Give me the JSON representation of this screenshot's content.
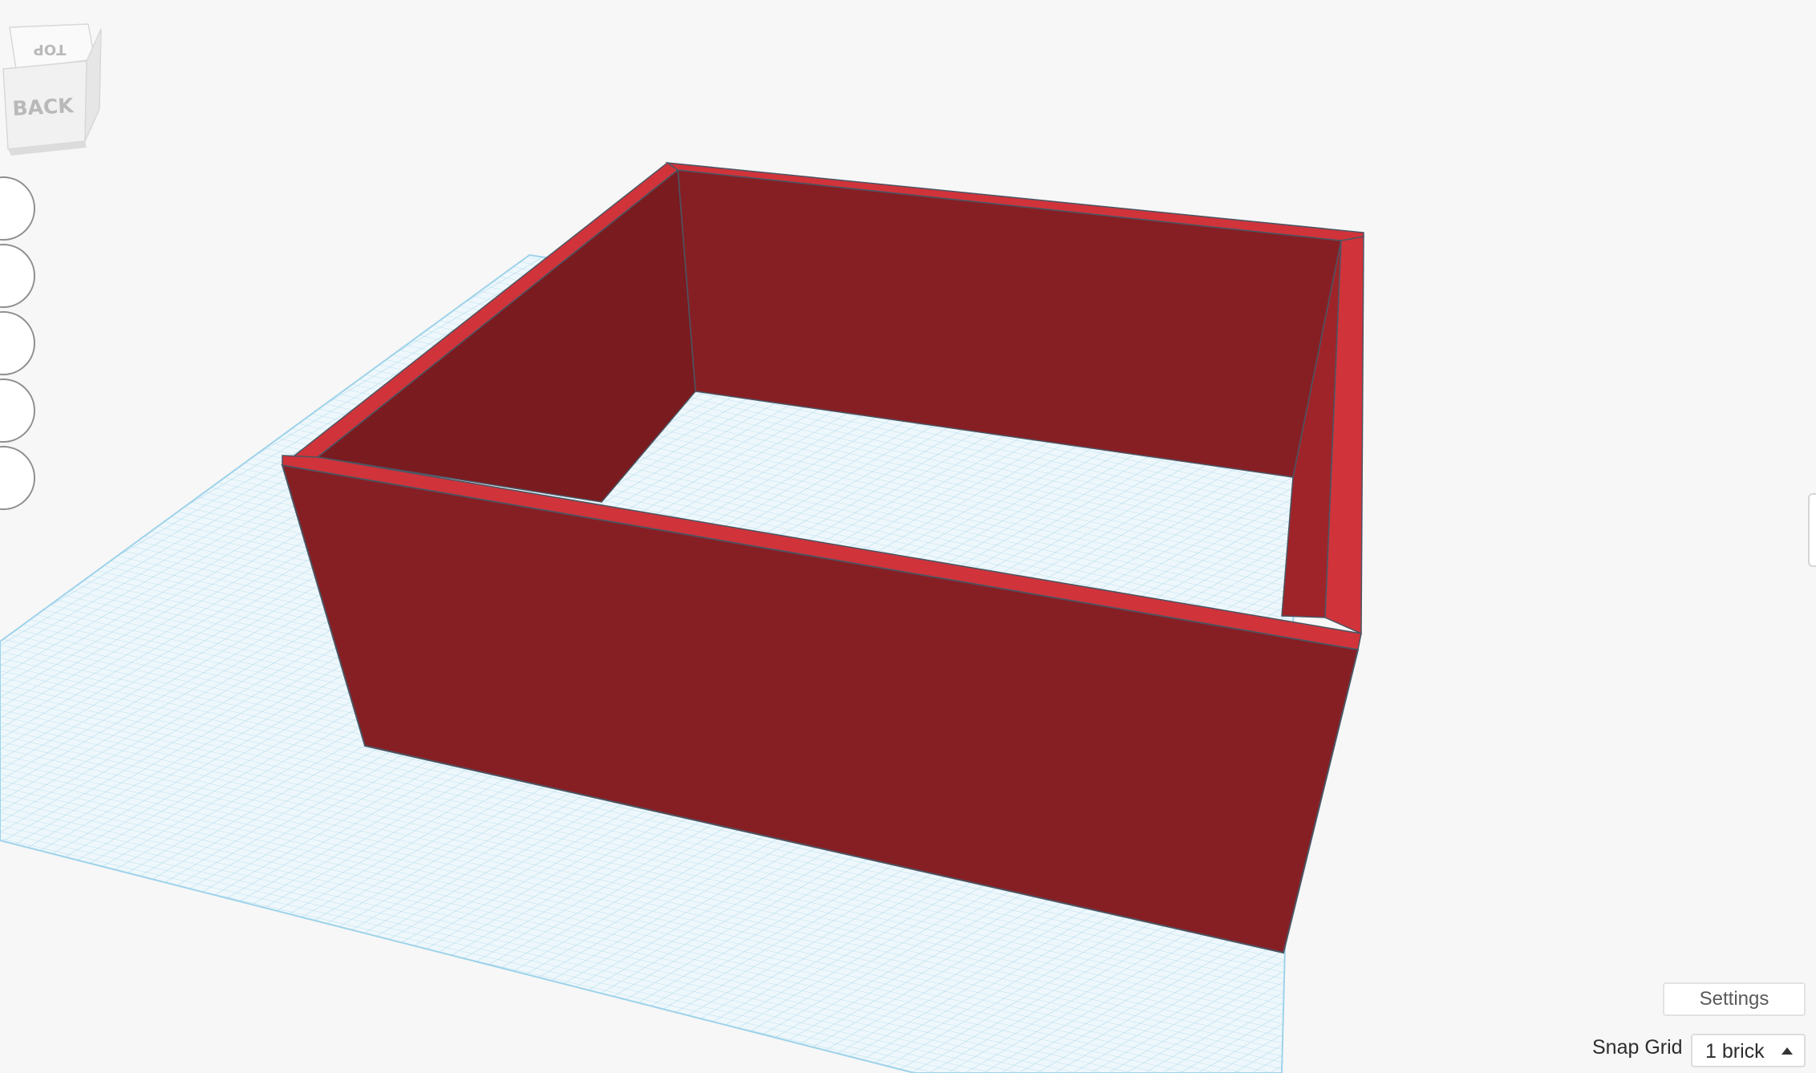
{
  "view_cube": {
    "top_label": "TOP",
    "back_label": "BACK"
  },
  "nav_controls": [
    {
      "name": "home-view-button",
      "icon": "home-icon"
    },
    {
      "name": "fit-view-button",
      "icon": "fit-to-view-icon"
    },
    {
      "name": "zoom-in-button",
      "icon": "plus-icon"
    },
    {
      "name": "zoom-out-button",
      "icon": "minus-icon"
    },
    {
      "name": "projection-button",
      "icon": "perspective-cube-icon"
    }
  ],
  "settings": {
    "label": "Settings"
  },
  "snap_grid": {
    "label": "Snap Grid",
    "value": "1 brick"
  },
  "colors": {
    "background": "#f7f7f7",
    "grid_line": "#9fd3ea",
    "workplane": "#eef7fb",
    "wall_face": "#861f24",
    "wall_inner": "#7a1b1f",
    "wall_top": "#d1333a",
    "edge": "#4b5563"
  }
}
